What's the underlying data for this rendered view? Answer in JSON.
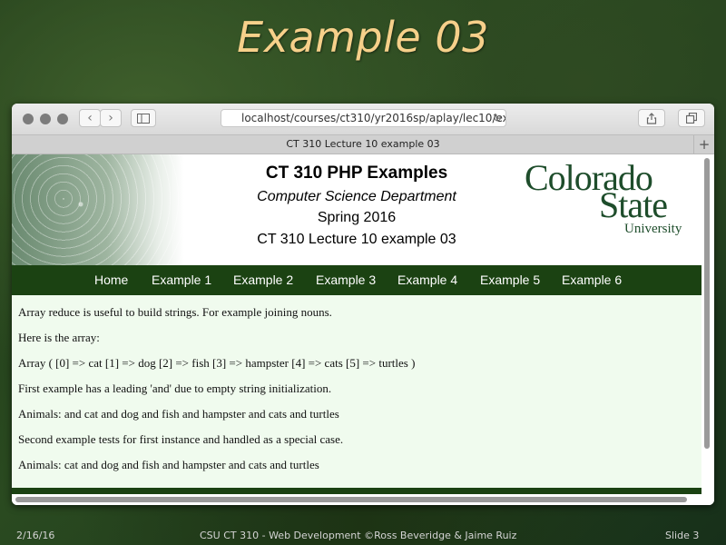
{
  "slide": {
    "title": "Example 03",
    "footer_date": "2/16/16",
    "footer_center": "CSU CT 310 - Web Development ©Ross Beveridge & Jaime Ruiz",
    "footer_slide": "Slide 3"
  },
  "browser": {
    "url": "localhost/courses/ct310/yr2016sp/aplay/lec10/exa",
    "tab_title": "CT 310 Lecture 10 example 03",
    "new_tab_label": "+"
  },
  "page": {
    "header": {
      "title": "CT 310 PHP Examples",
      "department": "Computer Science Department",
      "term": "Spring 2016",
      "subtitle": "CT 310 Lecture 10 example 03"
    },
    "logo": {
      "line1": "Colorado",
      "line2": "State",
      "line3": "University"
    },
    "menu": [
      "Home",
      "Example 1",
      "Example 2",
      "Example 3",
      "Example 4",
      "Example 5",
      "Example 6"
    ],
    "body_lines": [
      "Array reduce is useful to build strings. For example joining nouns.",
      "Here is the array:",
      "Array ( [0] => cat [1] => dog [2] => fish [3] => hampster [4] => cats [5] => turtles )",
      "First example has a leading 'and' due to empty string initialization.",
      "Animals: and cat and dog and fish and hampster and cats and turtles",
      "Second example tests for first instance and handled as a special case.",
      "Animals: cat and dog and fish and hampster and cats and turtles"
    ]
  },
  "colors": {
    "title": "#f6d08a",
    "nav_bar": "#1b4212",
    "content_bg": "#f0fbee",
    "logo_green": "#1e4d2b"
  },
  "icons": {
    "back": "chevron-left-icon",
    "forward": "chevron-right-icon",
    "sidebar": "sidebar-icon",
    "reload": "reload-icon",
    "share": "share-icon",
    "tabs": "tabs-icon"
  }
}
